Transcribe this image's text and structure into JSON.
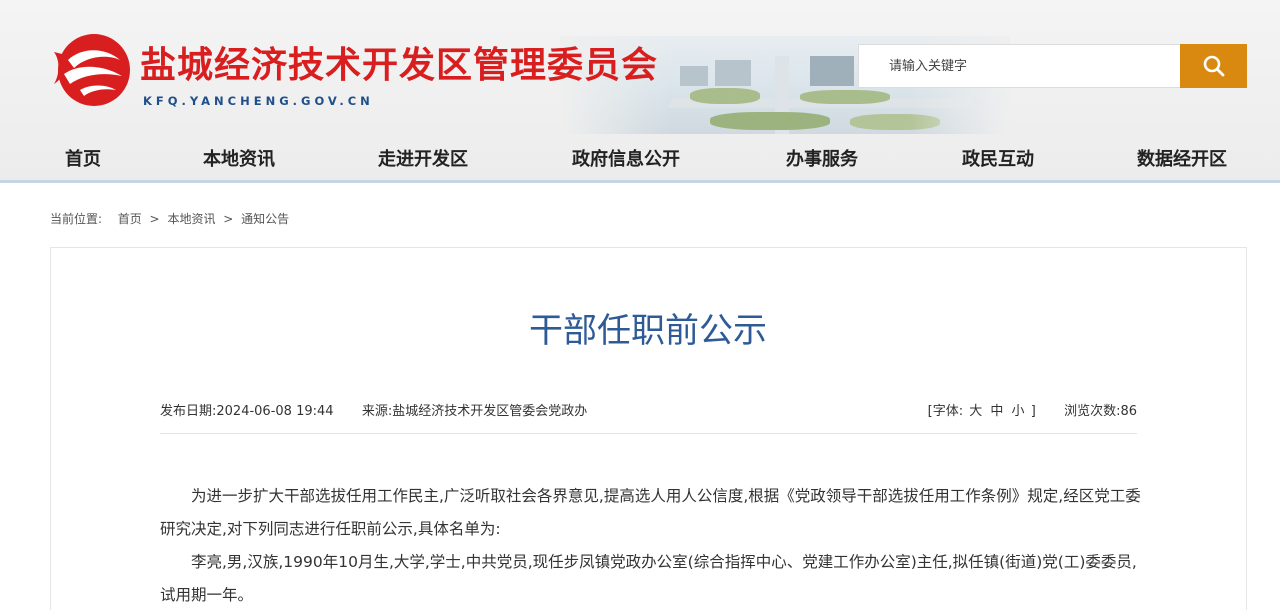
{
  "header": {
    "site_title": "盐城经济技术开发区管理委员会",
    "site_domain": "KFQ.YANCHENG.GOV.CN",
    "brand_color": "#d81e1e",
    "accent_color": "#d9890f"
  },
  "search": {
    "placeholder": "请输入关键字",
    "button_icon": "search-icon"
  },
  "nav": {
    "items": [
      {
        "label": "首页"
      },
      {
        "label": "本地资讯"
      },
      {
        "label": "走进开发区"
      },
      {
        "label": "政府信息公开"
      },
      {
        "label": "办事服务"
      },
      {
        "label": "政民互动"
      },
      {
        "label": "数据经开区"
      }
    ]
  },
  "breadcrumb": {
    "prefix": "当前位置:",
    "items": [
      "首页",
      "本地资讯",
      "通知公告"
    ],
    "separator": ">"
  },
  "article": {
    "title": "干部任职前公示",
    "publish_label": "发布日期:",
    "publish_date": "2024-06-08 19:44",
    "source_label": "来源:",
    "source": "盐城经济技术开发区管委会党政办",
    "font_label": "[字体:",
    "font_sizes": [
      "大",
      "中",
      "小"
    ],
    "font_close": "]",
    "views_label": "浏览次数:",
    "views": "86",
    "paragraphs": [
      "为进一步扩大干部选拔任用工作民主,广泛听取社会各界意见,提高选人用人公信度,根据《党政领导干部选拔任用工作条例》规定,经区党工委研究决定,对下列同志进行任职前公示,具体名单为:",
      "李亮,男,汉族,1990年10月生,大学,学士,中共党员,现任步凤镇党政办公室(综合指挥中心、党建工作办公室)主任,拟任镇(街道)党(工)委委员,试用期一年。"
    ]
  }
}
